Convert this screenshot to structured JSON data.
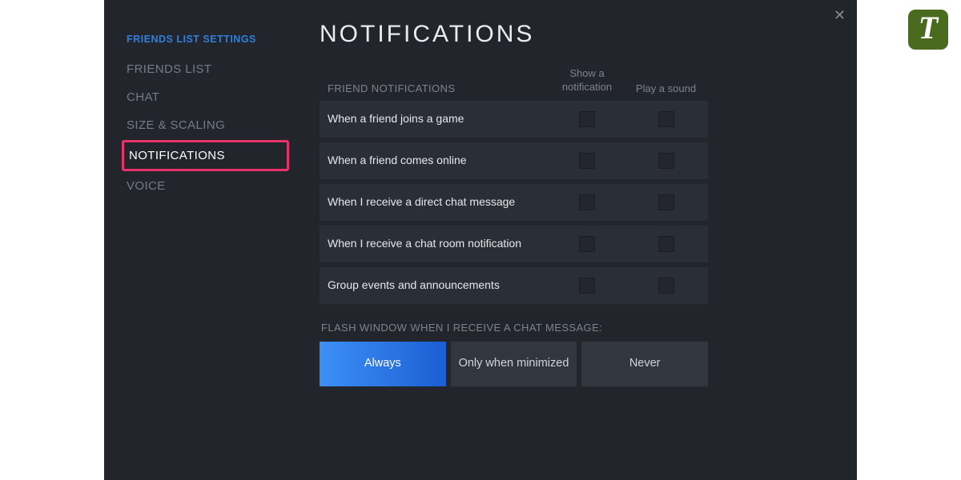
{
  "logo": {
    "letter": "T"
  },
  "close_glyph": "✕",
  "sidebar": {
    "title": "FRIENDS LIST SETTINGS",
    "items": [
      {
        "label": "FRIENDS LIST",
        "active": false
      },
      {
        "label": "CHAT",
        "active": false
      },
      {
        "label": "SIZE & SCALING",
        "active": false
      },
      {
        "label": "NOTIFICATIONS",
        "active": true
      },
      {
        "label": "VOICE",
        "active": false
      }
    ]
  },
  "page": {
    "title": "NOTIFICATIONS",
    "columns": {
      "section_header": "FRIEND NOTIFICATIONS",
      "show": "Show a notification",
      "sound": "Play a sound"
    },
    "rows": [
      {
        "label": "When a friend joins a game",
        "show": false,
        "sound": false
      },
      {
        "label": "When a friend comes online",
        "show": false,
        "sound": false
      },
      {
        "label": "When I receive a direct chat message",
        "show": false,
        "sound": false
      },
      {
        "label": "When I receive a chat room notification",
        "show": false,
        "sound": false
      },
      {
        "label": "Group events and announcements",
        "show": false,
        "sound": false
      }
    ],
    "flash": {
      "label": "FLASH WINDOW WHEN I RECEIVE A CHAT MESSAGE:",
      "options": [
        {
          "label": "Always",
          "selected": true
        },
        {
          "label": "Only when minimized",
          "selected": false
        },
        {
          "label": "Never",
          "selected": false
        }
      ]
    }
  }
}
